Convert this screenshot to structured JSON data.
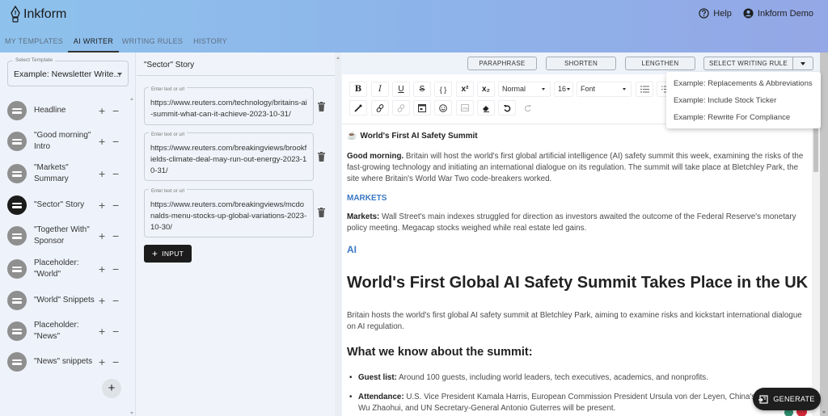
{
  "app": {
    "name": "Inkform",
    "nav_tabs": [
      {
        "label": "MY TEMPLATES",
        "active": false
      },
      {
        "label": "AI WRITER",
        "active": true
      },
      {
        "label": "WRITING RULES",
        "active": false
      },
      {
        "label": "HISTORY",
        "active": false
      }
    ],
    "help_label": "Help",
    "user_label": "Inkform Demo"
  },
  "sidebar": {
    "template_label": "Select Template",
    "template_value": "Example: Newsletter Write...",
    "sections": [
      {
        "label": "Headline",
        "active": false
      },
      {
        "label": "\"Good morning\" Intro",
        "active": false
      },
      {
        "label": "\"Markets\" Summary",
        "active": false
      },
      {
        "label": "\"Sector\" Story",
        "active": true
      },
      {
        "label": "\"Together With\" Sponsor",
        "active": false
      },
      {
        "label": "Placeholder: \"World\"",
        "active": false
      },
      {
        "label": "\"World\" Snippets",
        "active": false
      },
      {
        "label": "Placeholder: \"News\"",
        "active": false
      },
      {
        "label": "\"News\" snippets",
        "active": false
      }
    ],
    "add_symbol": "+",
    "plus_symbol": "+",
    "minus_symbol": "−"
  },
  "middle": {
    "title": "\"Sector\" Story",
    "inputs": [
      {
        "label": "Enter text or url",
        "value": "https://www.reuters.com/technology/britains-ai-summit-what-can-it-achieve-2023-10-31/"
      },
      {
        "label": "Enter text or url",
        "value": "https://www.reuters.com/breakingviews/brookfields-climate-deal-may-run-out-energy-2023-10-31/"
      },
      {
        "label": "Enter text or url",
        "value": "https://www.reuters.com/breakingviews/mcdonalds-menu-stocks-up-global-variations-2023-10-30/"
      }
    ],
    "add_input_label": "INPUT"
  },
  "editor": {
    "ai_actions": [
      "PARAPHRASE",
      "SHORTEN",
      "LENGTHEN"
    ],
    "writing_rule_label": "SELECT WRITING RULE",
    "writing_rules": [
      "Example: Replacements & Abbreviations",
      "Example: Include Stock Ticker",
      "Example: Rewrite For Compliance"
    ],
    "toolbar": {
      "bold": "B",
      "italic": "I",
      "underline": "U",
      "strike": "S",
      "code": "{ }",
      "superscript": "x²",
      "subscript": "x₂",
      "block_type": "Normal",
      "font_size": "16",
      "font_family": "Font"
    },
    "doc": {
      "emoji": "☕",
      "title": "World's First AI Safety Summit",
      "intro_lead": "Good morning.",
      "intro_text": " Britain will host the world's first global artificial intelligence (AI) safety summit this week, examining the risks of the fast-growing technology and initiating an international dialogue on its regulation. The summit will take place at Bletchley Park, the site where Britain's World War Two code-breakers worked.",
      "markets_heading": "MARKETS",
      "markets_lead": "Markets:",
      "markets_text": " Wall Street's main indexes struggled for direction as investors awaited the outcome of the Federal Reserve's monetary policy meeting. Megacap stocks weighed while real estate led gains.",
      "sector_heading": "AI",
      "h1": "World's First Global AI Safety Summit Takes Place in the UK",
      "summary": "Britain hosts the world's first global AI safety summit at Bletchley Park, aiming to examine risks and kickstart international dialogue on AI regulation.",
      "h2": "What we know about the summit:",
      "bullets": [
        {
          "lead": "Guest list:",
          "text": " Around 100 guests, including world leaders, tech executives, academics, and nonprofits."
        },
        {
          "lead": "Attendance:",
          "text": " U.S. Vice President Kamala Harris, European Commission President Ursula von der Leyen, China's tech minister Wu Zhaohui, and UN Secretary-General Antonio Guterres will be present."
        }
      ]
    },
    "generate_label": "GENERATE"
  }
}
